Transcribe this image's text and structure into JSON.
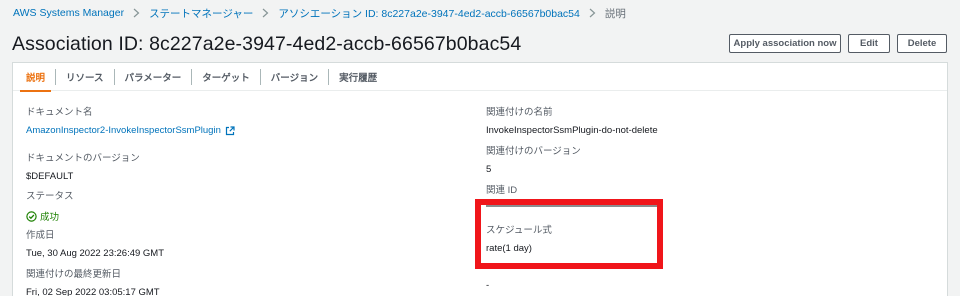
{
  "breadcrumb": [
    {
      "label": "AWS Systems Manager"
    },
    {
      "label": "ステートマネージャー"
    },
    {
      "label": "アソシエーション ID: 8c227a2e-3947-4ed2-accb-66567b0bac54"
    }
  ],
  "breadcrumb_current": "説明",
  "title": "Association ID: 8c227a2e-3947-4ed2-accb-66567b0bac54",
  "actions": {
    "apply": "Apply association now",
    "edit": "Edit",
    "delete": "Delete"
  },
  "tabs": [
    "説明",
    "リソース",
    "パラメーター",
    "ターゲット",
    "バージョン",
    "実行履歴"
  ],
  "left_fields": {
    "document_name": {
      "label": "ドキュメント名",
      "value": "AmazonInspector2-InvokeInspectorSsmPlugin"
    },
    "document_version": {
      "label": "ドキュメントのバージョン",
      "value": "$DEFAULT"
    },
    "status": {
      "label": "ステータス",
      "value": "成功"
    },
    "created": {
      "label": "作成日",
      "value": "Tue, 30 Aug 2022 23:26:49 GMT"
    },
    "last_updated": {
      "label": "関連付けの最終更新日",
      "value": "Fri, 02 Sep 2022 03:05:17 GMT"
    }
  },
  "right_fields": {
    "association_name": {
      "label": "関連付けの名前",
      "value": "InvokeInspectorSsmPlugin-do-not-delete"
    },
    "association_version": {
      "label": "関連付けのバージョン",
      "value": "5"
    },
    "association_id": {
      "label": "関連 ID"
    },
    "schedule": {
      "label": "スケジュール式",
      "value": "rate(1 day)"
    },
    "bottom_value": "-"
  },
  "colors": {
    "link": "#0073bb",
    "active_tab": "#ec7211",
    "success": "#1d8102",
    "highlight": "#f0151a"
  }
}
